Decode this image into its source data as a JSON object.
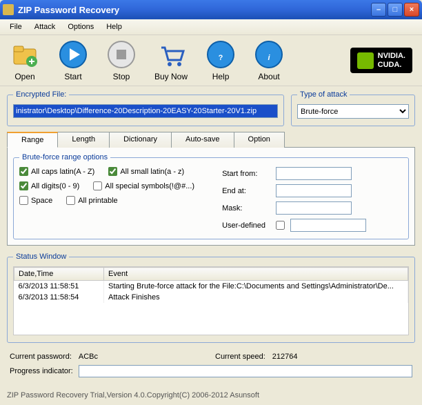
{
  "window": {
    "title": "ZIP Password Recovery"
  },
  "menu": [
    "File",
    "Attack",
    "Options",
    "Help"
  ],
  "toolbar": {
    "open": "Open",
    "start": "Start",
    "stop": "Stop",
    "buy": "Buy Now",
    "help": "Help",
    "about": "About"
  },
  "nvidia": {
    "brand": "NVIDIA.",
    "product": "CUDA."
  },
  "enc": {
    "legend": "Encrypted File:",
    "path": "inistrator\\Desktop\\Difference-20Description-20EASY-20Starter-20V1.zip"
  },
  "attack": {
    "legend": "Type of attack",
    "selected": "Brute-force"
  },
  "tabs": [
    "Range",
    "Length",
    "Dictionary",
    "Auto-save",
    "Option"
  ],
  "bf": {
    "legend": "Brute-force range options",
    "caps": "All caps latin(A - Z)",
    "small": "All small latin(a - z)",
    "digits": "All digits(0 - 9)",
    "symbols": "All special symbols(!@#...)",
    "space": "Space",
    "printable": "All printable",
    "startfrom": "Start from:",
    "endat": "End at:",
    "mask": "Mask:",
    "userdef": "User-defined"
  },
  "status": {
    "legend": "Status Window",
    "cols": {
      "dt": "Date,Time",
      "ev": "Event"
    },
    "rows": [
      {
        "dt": "6/3/2013 11:58:51",
        "ev": "Starting Brute-force attack for the File:C:\\Documents and Settings\\Administrator\\De..."
      },
      {
        "dt": "6/3/2013 11:58:54",
        "ev": "Attack Finishes"
      }
    ]
  },
  "current": {
    "pwlabel": "Current password:",
    "pwvalue": "ACBc",
    "splabel": "Current speed:",
    "spvalue": "212764"
  },
  "progress": {
    "label": "Progress indicator:"
  },
  "footer": "ZIP Password Recovery Trial,Version 4.0.Copyright(C) 2006-2012 Asunsoft"
}
